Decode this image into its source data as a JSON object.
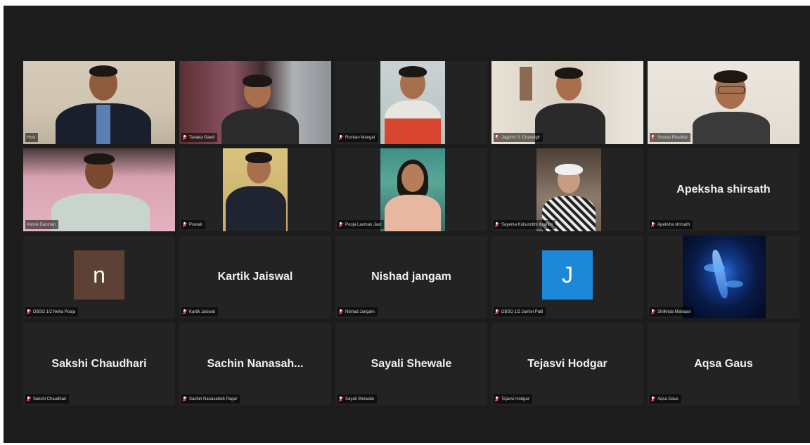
{
  "app": {
    "view": "gallery"
  },
  "participants": [
    {
      "key": "p1",
      "tag": "Host",
      "kind": "video",
      "active": true
    },
    {
      "key": "p2",
      "tag": "Tanaka Gawli",
      "kind": "video"
    },
    {
      "key": "p3",
      "tag": "Roshan Mangal",
      "kind": "video"
    },
    {
      "key": "p4",
      "tag": "Jagdish S. Chavdigir",
      "kind": "video"
    },
    {
      "key": "p5",
      "tag": "Sourav Bhadhal",
      "kind": "video"
    },
    {
      "key": "p6",
      "tag": "Ashok Darshan",
      "kind": "video"
    },
    {
      "key": "p7",
      "tag": "Pranali",
      "kind": "video"
    },
    {
      "key": "p8",
      "tag": "Pooja Laxman Jaut",
      "kind": "video"
    },
    {
      "key": "p9",
      "tag": "Sayema Kulsumbhi Ibrahim",
      "kind": "video"
    },
    {
      "key": "p10",
      "tag": "Apeksha shirsath",
      "display": "Apeksha shirsath",
      "kind": "name"
    },
    {
      "key": "p11",
      "tag": "DBSG 1/2 Neha Pooja",
      "initial": "n",
      "avatar_color": "#5c4134",
      "kind": "avatar"
    },
    {
      "key": "p12",
      "tag": "Kartik Jaiswal",
      "display": "Kartik Jaiswal",
      "kind": "name"
    },
    {
      "key": "p13",
      "tag": "Nishad Jangam",
      "display": "Nishad jangam",
      "kind": "name"
    },
    {
      "key": "p14",
      "tag": "DBSG 1/2 Janhvi Patil",
      "initial": "J",
      "avatar_color": "#1e88d8",
      "kind": "avatar"
    },
    {
      "key": "p15",
      "tag": "Shilkhda Mahajan",
      "kind": "image"
    },
    {
      "key": "p16",
      "tag": "Sakshi Chaudhari",
      "display": "Sakshi Chaudhari",
      "kind": "name"
    },
    {
      "key": "p17",
      "tag": "Sachin Nanasaheb Pagar",
      "display": "Sachin  Nanasah...",
      "kind": "name"
    },
    {
      "key": "p18",
      "tag": "Sayali Shewale",
      "display": "Sayali Shewale",
      "kind": "name"
    },
    {
      "key": "p19",
      "tag": "Tejasvi Hodgar",
      "display": "Tejasvi Hodgar",
      "kind": "name"
    },
    {
      "key": "p20",
      "tag": "Aqsa Gaus",
      "display": "Aqsa Gaus",
      "kind": "name"
    }
  ],
  "colors": {
    "background": "#1c1c1c",
    "tile": "#232323",
    "active_border": "#e8dc6a",
    "mic_muted": "#e0363a"
  }
}
